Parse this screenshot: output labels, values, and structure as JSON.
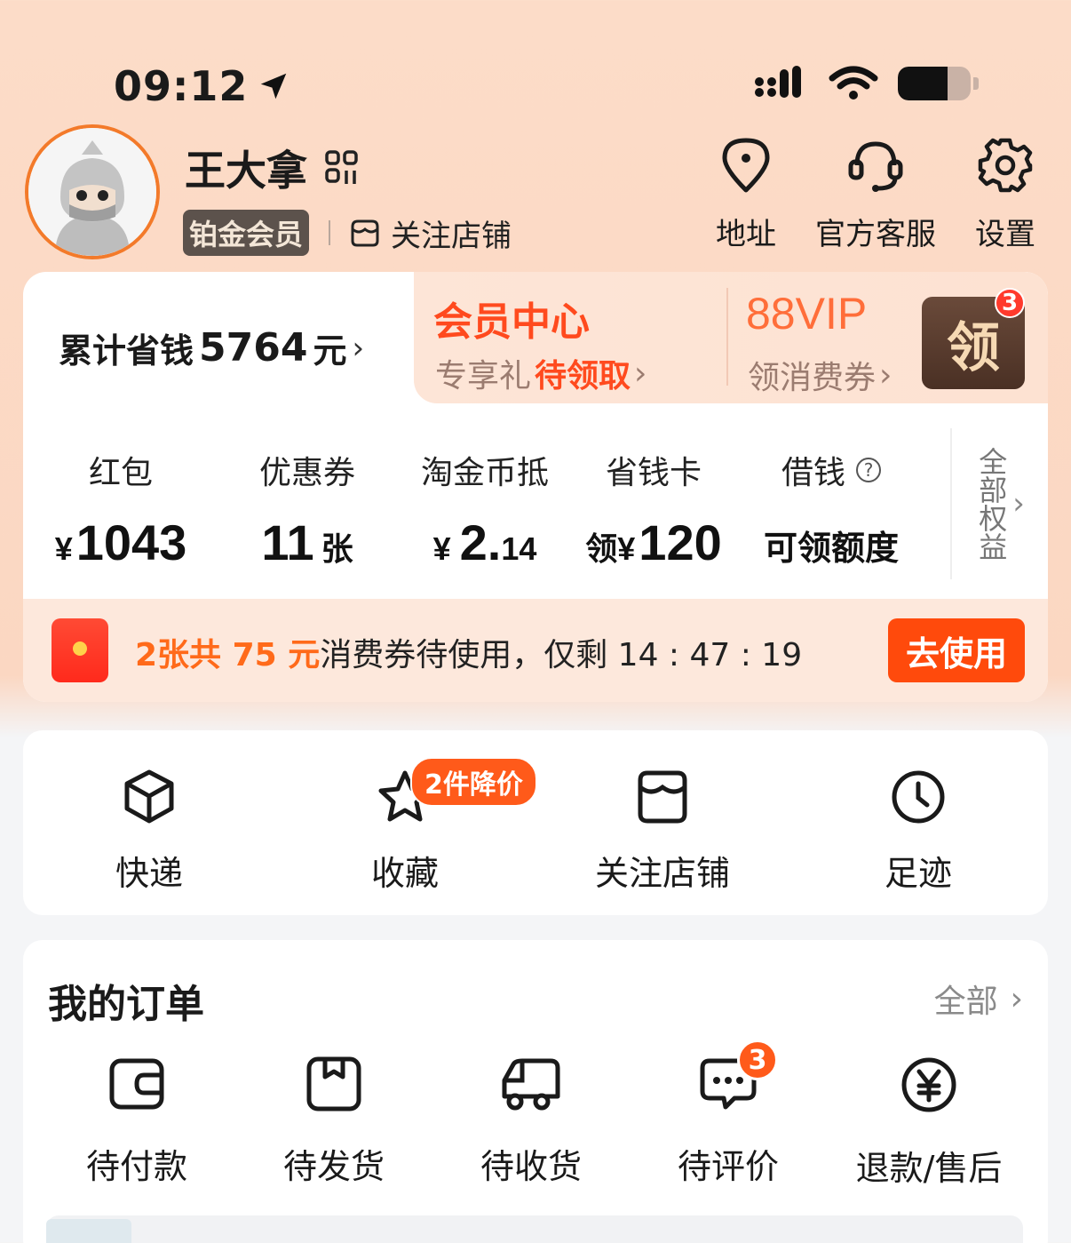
{
  "status": {
    "time": "09:12",
    "battery_level": 0.68
  },
  "profile": {
    "username": "王大拿",
    "member_level": "铂金会员",
    "follow_stores": "关注店铺"
  },
  "top_actions": [
    {
      "label": "地址",
      "icon": "location-pin-icon"
    },
    {
      "label": "官方客服",
      "icon": "headset-icon"
    },
    {
      "label": "设置",
      "icon": "gear-icon"
    }
  ],
  "benefits": {
    "savings_label": "累计省钱",
    "savings_amount": "5764",
    "savings_unit": "元",
    "member_center_title": "会员中心",
    "member_center_sub_prefix": "专享礼",
    "member_center_sub_highlight": "待领取",
    "vip_title": "88VIP",
    "vip_sub": "领消费券",
    "claim_label": "领",
    "claim_badge": "3",
    "stats": [
      {
        "label": "红包",
        "prefix": "¥",
        "value": "1043",
        "suffix": ""
      },
      {
        "label": "优惠券",
        "prefix": "",
        "value": "11",
        "suffix": "张"
      },
      {
        "label": "淘金币抵",
        "prefix": "¥",
        "value": "2.",
        "suffix": "14"
      },
      {
        "label": "省钱卡",
        "prefix": "领¥",
        "value": "120",
        "suffix": ""
      },
      {
        "label": "借钱",
        "prefix": "",
        "value": "可领额度",
        "suffix": ""
      }
    ],
    "all_rights": "全部权益",
    "coupon_highlight": "2张共 75 元",
    "coupon_text": "消费券待使用，仅剩 14 : 47 : 19",
    "use_button": "去使用"
  },
  "quick_links": [
    {
      "label": "快递",
      "icon": "package-icon"
    },
    {
      "label": "收藏",
      "icon": "star-icon"
    },
    {
      "label": "关注店铺",
      "icon": "store-icon"
    },
    {
      "label": "足迹",
      "icon": "clock-icon"
    }
  ],
  "price_drop_badge": "2件降价",
  "orders": {
    "title": "我的订单",
    "all": "全部",
    "items": [
      {
        "label": "待付款",
        "icon": "wallet-icon"
      },
      {
        "label": "待发货",
        "icon": "box-icon"
      },
      {
        "label": "待收货",
        "icon": "truck-icon"
      },
      {
        "label": "待评价",
        "icon": "chat-icon"
      },
      {
        "label": "退款/售后",
        "icon": "yuan-circle-icon"
      }
    ],
    "review_badge": "3"
  }
}
